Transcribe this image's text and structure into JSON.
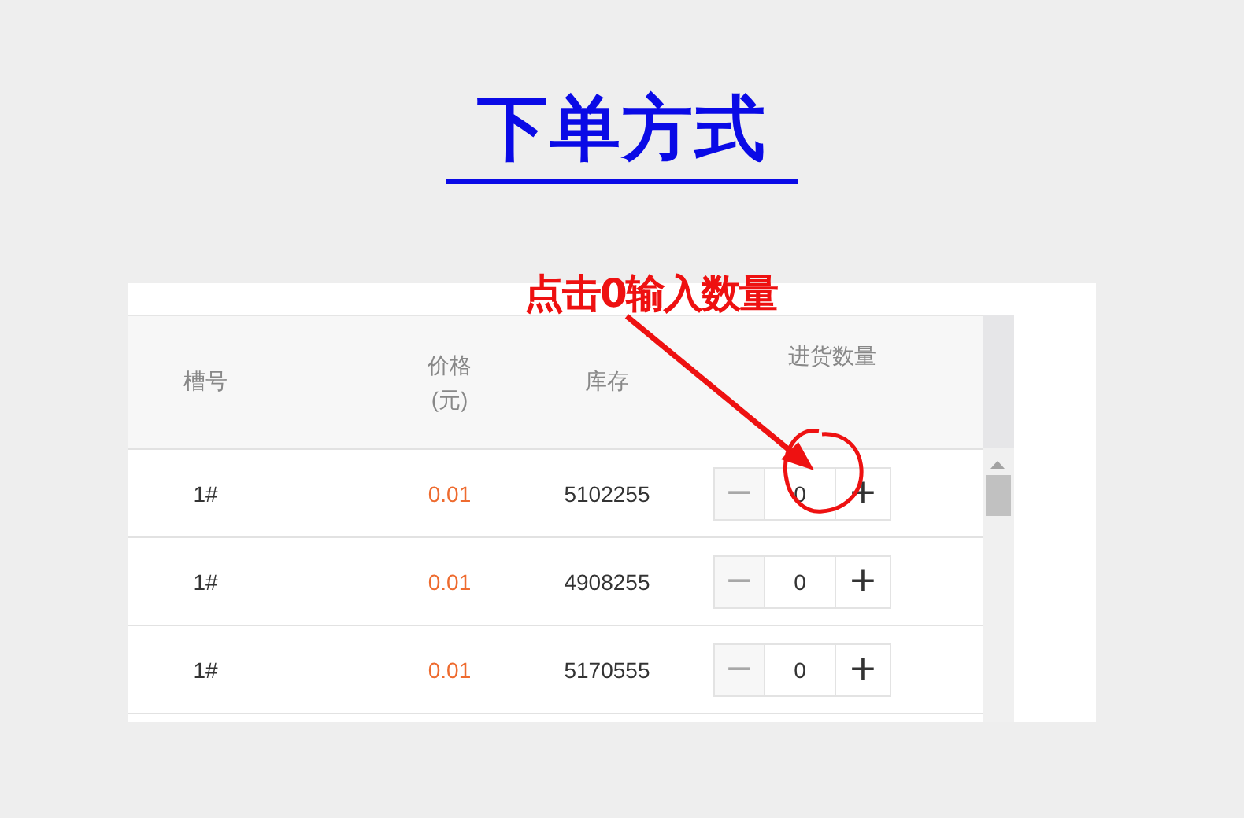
{
  "title": "下单方式",
  "annotation": {
    "text": "点击0输入数量"
  },
  "table": {
    "columns": [
      "槽号",
      "价格(元)",
      "库存",
      "进货数量"
    ],
    "rows": [
      {
        "slot": "1#",
        "price": "0.01",
        "stock": "5102255",
        "decrement_disabled": true,
        "quantity": "0",
        "decrement": "−",
        "increment": "+"
      },
      {
        "slot": "1#",
        "price": "0.01",
        "stock": "4908255",
        "decrement_disabled": true,
        "quantity": "0",
        "decrement": "−",
        "increment": "+"
      },
      {
        "slot": "1#",
        "price": "0.01",
        "stock": "5170555",
        "decrement_disabled": true,
        "quantity": "0",
        "decrement": "−",
        "increment": "+"
      }
    ]
  }
}
